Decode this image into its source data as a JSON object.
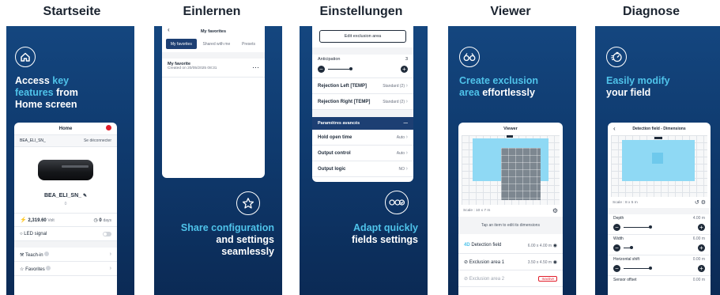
{
  "titles": [
    "Startseite",
    "Einlernen",
    "Einstellungen",
    "Viewer",
    "Diagnose"
  ],
  "colors": {
    "navy": "#123f76",
    "accent": "#4fc3ea",
    "selected_tab": "#1d3f73",
    "grid_blue": "#8fd9f4",
    "grid_gray": "#7d8790"
  },
  "p1": {
    "icon": "home-icon",
    "headline": {
      "a": "Access ",
      "b": "key",
      "c": "features",
      "d": " from",
      "e": "Home screen"
    },
    "phone": {
      "title": "Home",
      "device": "BEA_ELI_SN_",
      "logout": "Se déconnecter",
      "device_name": "BEA_ELI_SN_",
      "device_count": "0",
      "stat1_value": "2,319.60",
      "stat1_unit": "Volt",
      "stat2_value": "0",
      "stat2_unit": "days",
      "led": "LED signal",
      "teach": "Teach-in",
      "favorites": "Favorites"
    }
  },
  "p2": {
    "icon": "star-icon",
    "headline": {
      "a": "Share configuration",
      "b": "and settings",
      "c": "seamlessly"
    },
    "phone": {
      "title": "My favorites",
      "tabs": [
        "My favorites",
        "Shared with me",
        "Presets"
      ],
      "fav_title": "My favorite",
      "fav_date": "Created on 20/05/2025 08:31",
      "more": "⋯"
    }
  },
  "p3": {
    "icon": "adapt-fields-icon",
    "headline": {
      "a": "Adapt quickly",
      "b": "fields settings"
    },
    "phone": {
      "edit_button": "Edit exclusion area",
      "anticipation": "Anticipation",
      "anticipation_value": "3",
      "rejection_left": "Rejection Left [TEMP]",
      "rejection_left_value": "Standard (2)",
      "rejection_right": "Rejection Right [TEMP]",
      "rejection_right_value": "Standard (2)",
      "advanced": "Paramètres avancés",
      "hold_open": "Hold open time",
      "hold_open_value": "Auto",
      "output_control": "Output control",
      "output_control_value": "Auto",
      "output_logic": "Output logic",
      "output_logic_value": "NO"
    }
  },
  "p4": {
    "icon": "binoculars-icon",
    "headline": {
      "a": "Create exclusion",
      "b": "area",
      "c": " effortlessly"
    },
    "phone": {
      "title": "Viewer",
      "scale": "Scale : 10 x 7 m",
      "hint": "Tap an item to edit its dimensions",
      "detection_prefix": "4D",
      "detection": "Detection field",
      "detection_dims": "6.00 x 4.00 m",
      "excl1": "Exclusion area 1",
      "excl1_dims": "3.50 x 4.50 m",
      "excl2": "Exclusion area 2",
      "excl2_badge": "Inactive"
    }
  },
  "p5": {
    "icon": "diagnostic-gauge-icon",
    "headline": {
      "a": "Easily modify",
      "b": "your field"
    },
    "phone": {
      "title": "Detection field - Dimensions",
      "scale": "Scale : 8 x 5 m",
      "depth": "Depth",
      "depth_value": "4.00 m",
      "width": "Width",
      "width_value": "6.00 m",
      "hshift": "Horizontal shift",
      "hshift_value": "0.00 m",
      "sensor_offset": "Sensor offset",
      "sensor_offset_value": "0.00 m"
    }
  }
}
